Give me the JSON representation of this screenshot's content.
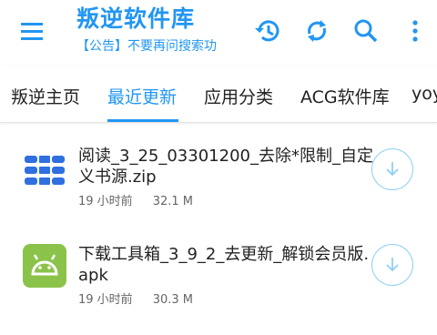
{
  "appbar": {
    "title": "叛逆软件库",
    "subtitle": "【公告】不要再问搜索功"
  },
  "tabs": [
    {
      "label": "叛逆主页"
    },
    {
      "label": "最近更新"
    },
    {
      "label": "应用分类"
    },
    {
      "label": "ACG软件库"
    },
    {
      "label": "yoy"
    }
  ],
  "active_tab": "最近更新",
  "files": [
    {
      "name": "阅读_3_25_03301200_去除*限制_自定义书源.zip",
      "time": "19 小时前",
      "size": "32.1 M",
      "icon": "striped-archive-icon"
    },
    {
      "name": "下载工具箱_3_9_2_去更新_解锁会员版.apk",
      "time": "19 小时前",
      "size": "30.3 M",
      "icon": "android-icon"
    }
  ],
  "colors": {
    "accent": "#2196F3",
    "android": "#8BC34A",
    "download_ring": "#8fd0f3"
  }
}
